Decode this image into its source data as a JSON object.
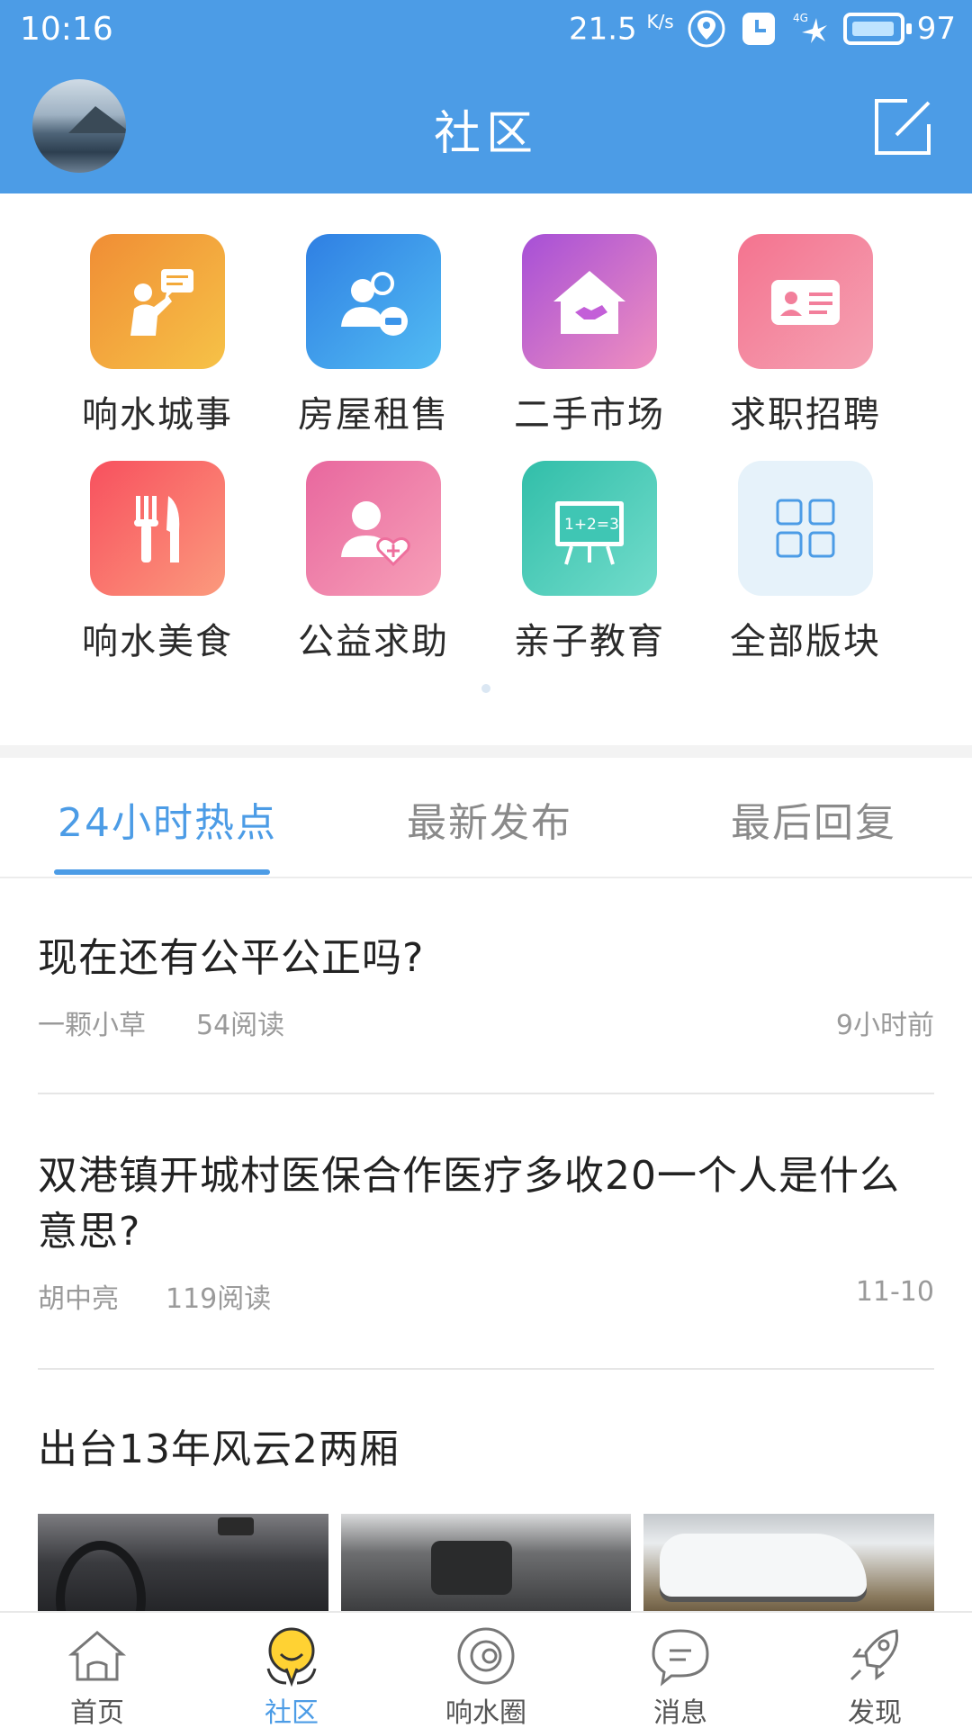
{
  "status_bar": {
    "time": "10:16",
    "speed": "21.5",
    "speed_unit": "K/s",
    "battery": "97",
    "network": "4G"
  },
  "header": {
    "title": "社区",
    "edit_icon": "edit-icon"
  },
  "categories": [
    {
      "label": "响水城事",
      "icon": "chat-person-icon",
      "color": "#f3a93a"
    },
    {
      "label": "房屋租售",
      "icon": "people-car-icon",
      "color": "#3c95ea"
    },
    {
      "label": "二手市场",
      "icon": "house-handshake-icon",
      "color": "#c35fd8"
    },
    {
      "label": "求职招聘",
      "icon": "id-card-icon",
      "color": "#f27f9b"
    },
    {
      "label": "响水美食",
      "icon": "fork-knife-icon",
      "color": "#f8646a"
    },
    {
      "label": "公益求助",
      "icon": "person-heart-icon",
      "color": "#ee6f9d"
    },
    {
      "label": "亲子教育",
      "icon": "blackboard-icon",
      "color": "#3fc6b4"
    },
    {
      "label": "全部版块",
      "icon": "grid-icon",
      "color": "#e6f2fa"
    }
  ],
  "tabs": [
    {
      "label": "24小时热点",
      "active": true
    },
    {
      "label": "最新发布",
      "active": false
    },
    {
      "label": "最后回复",
      "active": false
    }
  ],
  "posts": [
    {
      "title": "现在还有公平公正吗?",
      "author": "一颗小草",
      "reads": "54阅读",
      "time": "9小时前"
    },
    {
      "title": "双港镇开城村医保合作医疗多收20一个人是什么意思?",
      "author": "胡中亮",
      "reads": "119阅读",
      "time": "11-10"
    },
    {
      "title": "出台13年风云2两厢"
    }
  ],
  "bottom_nav": [
    {
      "label": "首页",
      "icon": "home-icon",
      "active": false
    },
    {
      "label": "社区",
      "icon": "community-icon",
      "active": true
    },
    {
      "label": "响水圈",
      "icon": "circle-icon",
      "active": false
    },
    {
      "label": "消息",
      "icon": "message-icon",
      "active": false
    },
    {
      "label": "发现",
      "icon": "rocket-icon",
      "active": false
    }
  ],
  "colors": {
    "primary": "#4c9ce6",
    "text": "#222222",
    "muted": "#9a9a9a"
  }
}
